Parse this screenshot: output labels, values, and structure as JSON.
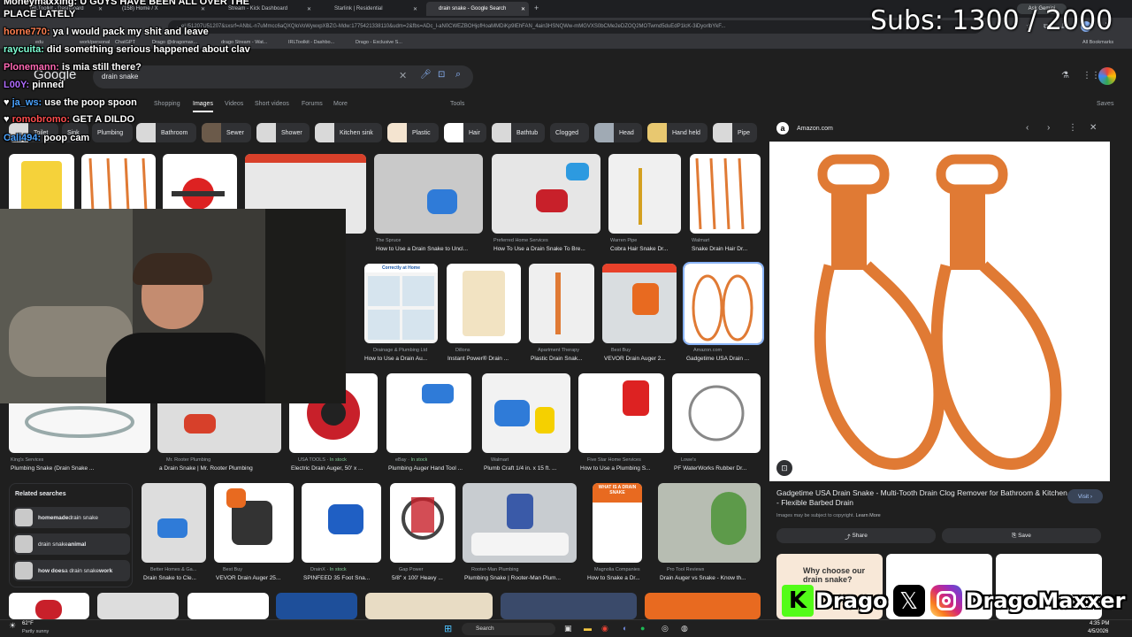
{
  "browser": {
    "tabs": [
      {
        "label": "IRLToolkit - Dashboard"
      },
      {
        "label": "(158) Home / X"
      },
      {
        "label": "Stream - Kick Dashboard"
      },
      {
        "label": "Starlink | Residential"
      },
      {
        "label": "drain snake - Google Search"
      }
    ],
    "url": "...eU51207U51207&sxsrf=ANbL-n7uMmcc6aQXQloVoWywxpXBZG-Mdw:1775421338110&udm=2&fbs=ADc_l-aN0CWEZBOHjofHoaMMDiKp9lEhFAN_4ain3HSNQWw-mMGVXS0bCMe2eDZOQ2MOTwmd5duEdP1lcK-3iDyorlbYkF...",
    "ask_gemini": "Ask Gemini",
    "bookmarks": [
      "edu",
      "work/personal",
      "ChatGPT",
      "Drago @dragomax...",
      "drago Stream - Wat...",
      "IRLToolkit - Dashbo...",
      "Drago - Exclusive S..."
    ],
    "all_bookmarks": "All Bookmarks"
  },
  "google": {
    "logo": "Google",
    "search_value": "drain snake",
    "nav_tabs": [
      "Shopping",
      "Images",
      "Videos",
      "Short videos",
      "Forums",
      "More"
    ],
    "tools": "Tools",
    "saves": "Saves",
    "chips": [
      "Toilet",
      "Sink",
      "Plumbing",
      "Bathroom",
      "Sewer",
      "Shower",
      "Kitchen sink",
      "Plastic",
      "Hair",
      "Bathtub",
      "Clogged",
      "Head",
      "Hand held",
      "Pipe"
    ]
  },
  "results": {
    "row1": [
      {
        "src": "The Spruce",
        "title": "How to Use a Drain Snake to Uncl..."
      },
      {
        "src": "Preferred Home Services",
        "title": "How To Use a Drain Snake To Bre..."
      },
      {
        "src": "Warren Pipe",
        "title": "Cobra Hair Snake Dr..."
      },
      {
        "src": "Walmart",
        "title": "Snake Drain Hair Dr..."
      }
    ],
    "row2": [
      {
        "src": "Drainage & Plumbing Ltd",
        "title": "How to Use a Drain Au..."
      },
      {
        "src": "Dillons",
        "title": "Instant Power® Drain ..."
      },
      {
        "src": "Apartment Therapy",
        "title": "Plastic Drain Snak..."
      },
      {
        "src": "Best Buy",
        "title": "VEVOR Drain Auger 2..."
      },
      {
        "src": "Amazon.com",
        "title": "Gadgetime USA Drain ..."
      }
    ],
    "row2_banner": "Correctly at Home",
    "row3": [
      {
        "src": "King's Services",
        "title": "Plumbing Snake (Drain Snake ...",
        "stock": ""
      },
      {
        "src": "Mr. Rooter Plumbing",
        "title": "a Drain Snake | Mr. Rooter Plumbing",
        "stock": ""
      },
      {
        "src": "USA TOOLS",
        "title": "Electric Drain Auger, 50' x ...",
        "stock": "In stock"
      },
      {
        "src": "eBay",
        "title": "Plumbing Auger Hand Tool ...",
        "stock": "In stock"
      },
      {
        "src": "Walmart",
        "title": "Plumb Craft 1/4 in. x 15 ft. ...",
        "stock": ""
      },
      {
        "src": "Five Star Home Services",
        "title": "How to Use a Plumbing S...",
        "stock": ""
      },
      {
        "src": "Lowe's",
        "title": "PF WaterWorks Rubber Dr...",
        "stock": ""
      }
    ],
    "row4": [
      {
        "src": "Better Homes & Ga...",
        "title": "Drain Snake to Cle...",
        "stock": ""
      },
      {
        "src": "Best Buy",
        "title": "VEVOR Drain Auger 25...",
        "stock": ""
      },
      {
        "src": "DrainX",
        "title": "SPINFEED 35 Foot Sna...",
        "stock": "In stock"
      },
      {
        "src": "Gap Power",
        "title": "5/8\" x 100' Heavy ...",
        "stock": ""
      },
      {
        "src": "Rooter-Man Plumbing",
        "title": "Plumbing Snake | Rooter-Man Plum...",
        "stock": ""
      },
      {
        "src": "Magnolia Companies",
        "title": "How to Snake a Dr...",
        "stock": ""
      },
      {
        "src": "Pro Tool Reviews",
        "title": "Drain Auger vs Snake - Know th...",
        "stock": ""
      }
    ],
    "row4_banner": "WHAT IS A DRAIN SNAKE"
  },
  "related": {
    "heading": "Related searches",
    "items": [
      {
        "bold": "homemade",
        "rest": " drain snake"
      },
      {
        "bold": "",
        "rest": "drain snake ",
        "bold2": "animal"
      },
      {
        "bold": "how does",
        "rest": " a drain snake ",
        "bold2": "work"
      }
    ]
  },
  "panel": {
    "source": "Amazon.com",
    "title": "Gadgetime USA Drain Snake - Multi-Tooth Drain Clog Remover for Bathroom & Kitchen - Flexible Barbed Drain",
    "visit": "Visit",
    "copyright": "Images may be subject to copyright.",
    "learn_more": "Learn More",
    "share": "Share",
    "save": "Save",
    "below_text": "Why choose our drain snake?"
  },
  "taskbar": {
    "temp": "62°F",
    "weather": "Partly sunny",
    "search": "Search",
    "time": "4:35 PM",
    "date": "4/5/2026"
  },
  "overlay": {
    "chat": [
      {
        "user": "Moneymaxxing:",
        "msg": "U GUYS HAVE BEEN ALL OVER THE",
        "color": "#ffffff"
      },
      {
        "user": "",
        "msg": "PLACE LATELY",
        "color": "#ffffff"
      },
      {
        "user": "horne770:",
        "msg": "ya I would pack my shit and leave",
        "color": "#ff7f50"
      },
      {
        "user": "raycuita:",
        "msg": "did something serious happened about clav",
        "color": "#7fffd4"
      },
      {
        "user": "Plonemann:",
        "msg": "is mia still there?",
        "color": "#ff69b4"
      },
      {
        "user": "L00Y:",
        "msg": "pinned",
        "color": "#b06cff"
      },
      {
        "user": "ja_ws:",
        "msg": "use the poop spoon",
        "color": "#4aa3ff"
      },
      {
        "user": "romobromo:",
        "msg": "GET A DILDO",
        "color": "#ff4d4d"
      },
      {
        "user": "Cali494:",
        "msg": "poop cam",
        "color": "#4aa3ff"
      }
    ],
    "subs": "Subs: 1300 / 2000",
    "social_name1": "Drago",
    "social_name2": "DragoMaxxer"
  },
  "colors": {
    "page_bg": "#1f1f1f",
    "kick_green": "#53fc18",
    "accent_blue": "#a8c7fa",
    "orange_product": "#e07a34"
  }
}
